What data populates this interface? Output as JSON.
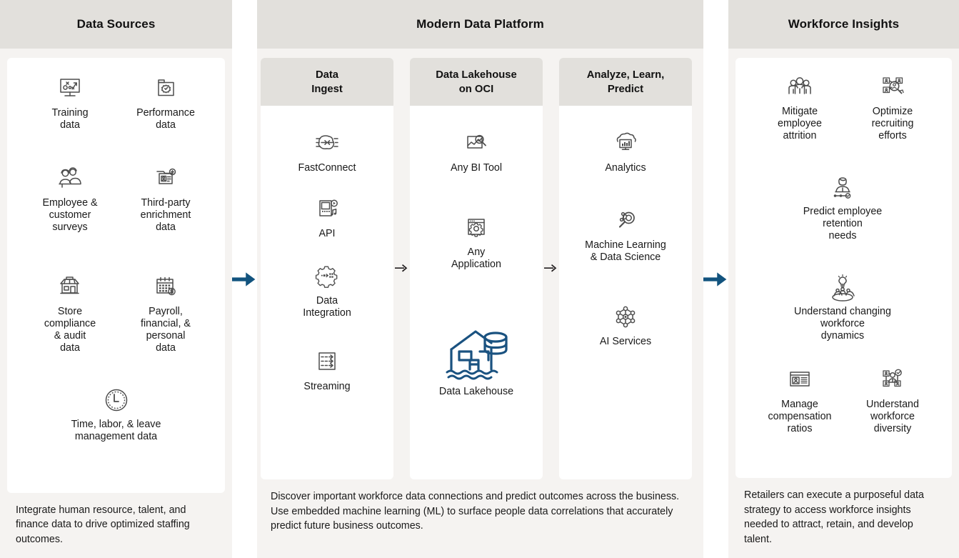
{
  "colors": {
    "panel_header_bg": "#E2E0DC",
    "panel_bg": "#F5F3F1",
    "card_bg": "#FFFFFF",
    "arrow_blue": "#12537E",
    "lakehouse_blue": "#1A5280",
    "icon_gray": "#4D4D4D",
    "text": "#1A1A1A"
  },
  "panels": {
    "left": {
      "title": "Data Sources",
      "items": [
        {
          "label": "Training\ndata",
          "icon": "whiteboard-strategy-icon"
        },
        {
          "label": "Performance\ndata",
          "icon": "folder-badge-icon"
        },
        {
          "label": "Employee &\ncustomer\nsurveys",
          "icon": "two-people-icon"
        },
        {
          "label": "Third-party\nenrichment\ndata",
          "icon": "id-card-plus-icon"
        },
        {
          "label": "Store\ncompliance\n& audit\ndata",
          "icon": "storefront-icon"
        },
        {
          "label": "Payroll,\nfinancial, &\npersonal\ndata",
          "icon": "calendar-money-icon"
        },
        {
          "label": "Time, labor, & leave\nmanagement data",
          "icon": "clock-icon"
        }
      ],
      "footer": "Integrate human resource, talent, and finance data to drive optimized staffing outcomes."
    },
    "middle": {
      "title": "Modern Data Platform",
      "columns": [
        {
          "title": "Data\nIngest",
          "items": [
            {
              "label": "FastConnect",
              "icon": "fastconnect-icon"
            },
            {
              "label": "API",
              "icon": "api-device-icon"
            },
            {
              "label": "Data\nIntegration",
              "icon": "gear-data-icon"
            },
            {
              "label": "Streaming",
              "icon": "streaming-icon"
            }
          ]
        },
        {
          "title": "Data Lakehouse\non OCI",
          "items": [
            {
              "label": "Any BI Tool",
              "icon": "bi-chart-magnifier-icon"
            },
            {
              "label": "Any\nApplication",
              "icon": "window-gear-icon"
            },
            {
              "label": "Data Lakehouse",
              "icon": "data-lakehouse-icon"
            }
          ]
        },
        {
          "title": "Analyze, Learn,\nPredict",
          "items": [
            {
              "label": "Analytics",
              "icon": "cloud-analytics-icon"
            },
            {
              "label": "Machine Learning\n& Data Science",
              "icon": "ml-magnifier-icon"
            },
            {
              "label": "AI Services",
              "icon": "neural-network-icon"
            }
          ]
        }
      ],
      "inner_arrows": [
        "arrow-right-icon",
        "arrow-right-icon"
      ],
      "footer": "Discover important workforce data connections and predict outcomes across the business. Use embedded machine learning (ML) to surface people data correlations that accurately predict future business outcomes."
    },
    "right": {
      "title": "Workforce Insights",
      "items": [
        {
          "label": "Mitigate\nemployee\nattrition",
          "icon": "group-people-icon"
        },
        {
          "label": "Optimize\nrecruiting\nefforts",
          "icon": "candidate-search-icon"
        },
        {
          "label": "Predict employee\nretention\nneeds",
          "icon": "employee-timeline-icon"
        },
        {
          "label": "Understand changing\nworkforce\ndynamics",
          "icon": "lightbulb-team-icon"
        },
        {
          "label": "Manage\ncompensation\nratios",
          "icon": "profile-list-icon"
        },
        {
          "label": "Understand\nworkforce\ndiversity",
          "icon": "org-diversity-icon"
        }
      ],
      "footer": "Retailers can execute a purposeful data strategy to access workforce insights needed to attract, retain, and develop talent."
    }
  },
  "flow_arrows": [
    "arrow-right-large-icon",
    "arrow-right-large-icon"
  ]
}
